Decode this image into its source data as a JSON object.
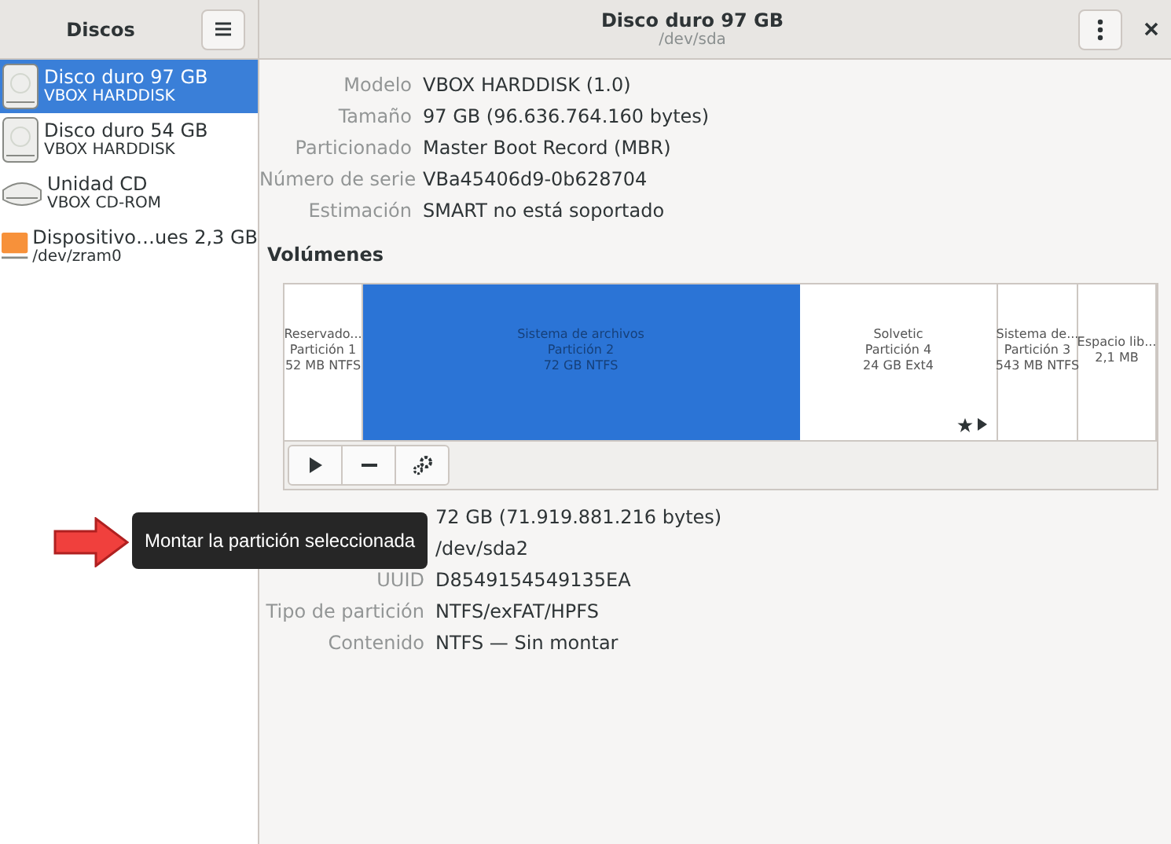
{
  "sidebar": {
    "title": "Discos",
    "devices": [
      {
        "name": "Disco duro 97 GB",
        "subtitle": "VBOX HARDDISK",
        "kind": "disk",
        "selected": true
      },
      {
        "name": "Disco duro 54 GB",
        "subtitle": "VBOX HARDDISK",
        "kind": "disk",
        "selected": false
      },
      {
        "name": "Unidad CD",
        "subtitle": "VBOX CD-ROM",
        "kind": "cd",
        "selected": false
      },
      {
        "name": "Dispositivo…ues 2,3 GB",
        "subtitle": "/dev/zram0",
        "kind": "zram",
        "selected": false
      }
    ]
  },
  "header": {
    "title": "Disco duro 97 GB",
    "subtitle": "/dev/sda"
  },
  "drive_details": [
    {
      "label": "Modelo",
      "value": "VBOX HARDDISK (1.0)"
    },
    {
      "label": "Tamaño",
      "value": "97 GB (96.636.764.160 bytes)"
    },
    {
      "label": "Particionado",
      "value": "Master Boot Record (MBR)"
    },
    {
      "label": "Número de serie",
      "value": "VBa45406d9-0b628704"
    },
    {
      "label": "Estimación",
      "value": "SMART no está soportado"
    }
  ],
  "volumes": {
    "heading": "Volúmenes",
    "partitions": [
      {
        "lines": [
          "Reservado...",
          "Partición 1",
          "52 MB NTFS"
        ],
        "selected": false,
        "marked": false
      },
      {
        "lines": [
          "Sistema de archivos",
          "Partición 2",
          "72 GB NTFS"
        ],
        "selected": true,
        "marked": false
      },
      {
        "lines": [
          "Solvetic",
          "Partición 4",
          "24 GB Ext4"
        ],
        "selected": false,
        "marked": true
      },
      {
        "lines": [
          "Sistema de...",
          "Partición 3",
          "543 MB NTFS"
        ],
        "selected": false,
        "marked": false
      },
      {
        "lines": [
          "Espacio lib...",
          "2,1 MB"
        ],
        "selected": false,
        "marked": false
      }
    ]
  },
  "partition_details": [
    {
      "value": "72 GB (71.919.881.216 bytes)"
    },
    {
      "value": "/dev/sda2"
    },
    {
      "label": "UUID",
      "value": "D8549154549135EA"
    },
    {
      "label": "Tipo de partición",
      "value": "NTFS/exFAT/HPFS"
    },
    {
      "label": "Contenido",
      "value": "NTFS — Sin montar"
    }
  ],
  "tooltip": {
    "text": "Montar la partición seleccionada"
  }
}
